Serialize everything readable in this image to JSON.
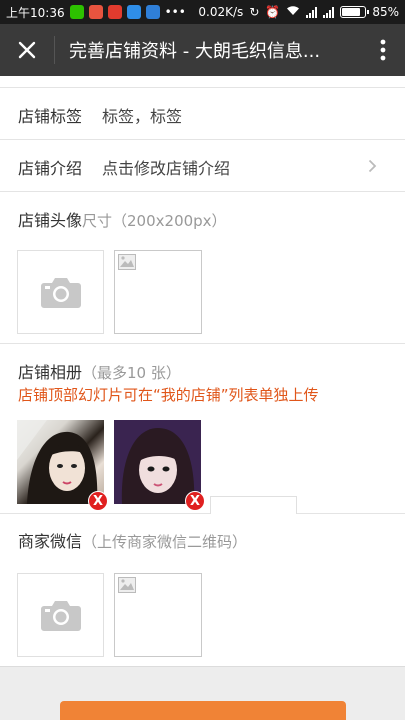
{
  "status_bar": {
    "time": "上午10:36",
    "net_speed": "0.02K/s",
    "battery": "85%",
    "battery_level": 0.85,
    "app_icons": [
      "wechat-icon",
      "app-icon-red",
      "app-icon-red2",
      "app-icon-blue",
      "app-icon-blue2"
    ]
  },
  "titlebar": {
    "title": "完善店铺资料 - 大朗毛织信息..."
  },
  "form": {
    "tags_label": "店铺标签",
    "tags_value": "标签，标签",
    "intro_label": "店铺介绍",
    "intro_value": "点击修改店铺介绍",
    "avatar_label": "店铺头像",
    "avatar_hint": "尺寸（200x200px）",
    "album_label": "店铺相册",
    "album_hint": "（最多10 张）",
    "album_warning": "店铺顶部幻灯片可在“我的店铺”列表单独上传",
    "wechat_label": "商家微信",
    "wechat_hint": "（上传商家微信二维码）",
    "delete_badge": "X"
  },
  "colors": {
    "accent": "#f08336",
    "warning": "#e0561a",
    "delete": "#e02020",
    "titlebar": "#3a3a3a"
  }
}
